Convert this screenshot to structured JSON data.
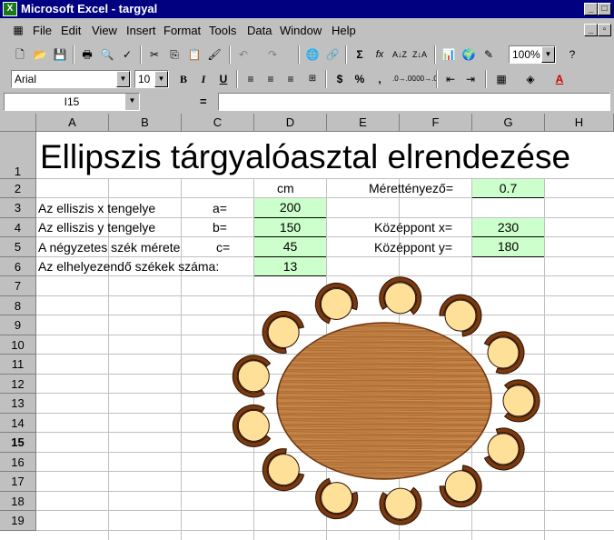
{
  "window": {
    "title": "Microsoft Excel - targyal"
  },
  "menu": [
    "File",
    "Edit",
    "View",
    "Insert",
    "Format",
    "Tools",
    "Data",
    "Window",
    "Help"
  ],
  "toolbar": {
    "zoom": "100%",
    "font": "Arial",
    "size": "10"
  },
  "namebox": "I15",
  "formula_eq": "=",
  "columns": [
    "A",
    "B",
    "C",
    "D",
    "E",
    "F",
    "G",
    "H"
  ],
  "rows": [
    "1",
    "2",
    "3",
    "4",
    "5",
    "6",
    "7",
    "8",
    "9",
    "10",
    "11",
    "12",
    "13",
    "14",
    "15",
    "16",
    "17",
    "18",
    "19"
  ],
  "sheet": {
    "title": "Ellipszis tárgyalóasztal elrendezése",
    "unit": "cm",
    "scale_label": "Mérettényező=",
    "scale_value": "0.7",
    "r3_label": "Az elliszis  x tengelye",
    "r3_var": "a=",
    "r3_value": "200",
    "r4_label": "Az elliszis y tengelye",
    "r4_var": "b=",
    "r4_value": "150",
    "r4_clabel": "Középpont x=",
    "r4_cvalue": "230",
    "r5_label": "A négyzetes szék mérete",
    "r5_var": "c=",
    "r5_value": "45",
    "r5_clabel": "Középpont y=",
    "r5_cvalue": "180",
    "r6_label": "Az elhelyezendő székek száma:",
    "r6_value": "13"
  },
  "drawing": {
    "chair_count": 13,
    "table_color": "#c08040",
    "chair_seat_color": "#ffe099",
    "chair_back_color": "#7a3a10"
  }
}
